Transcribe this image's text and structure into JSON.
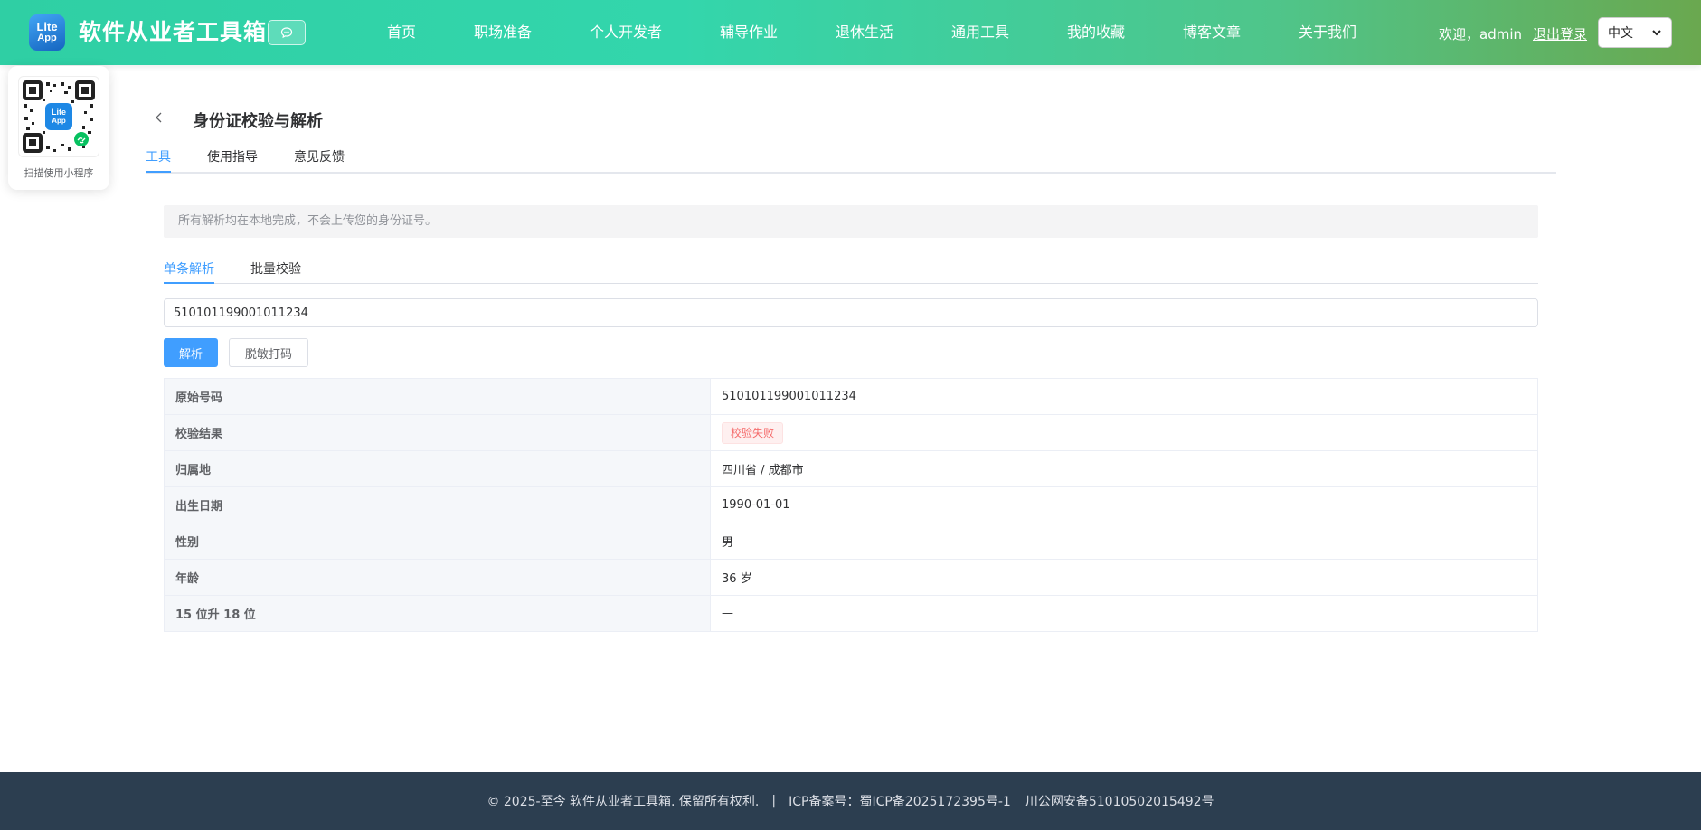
{
  "header": {
    "logo_line1": "Lite",
    "logo_line2": "App",
    "site_title": "软件从业者工具箱",
    "nav": [
      {
        "label": "首页"
      },
      {
        "label": "职场准备"
      },
      {
        "label": "个人开发者"
      },
      {
        "label": "辅导作业"
      },
      {
        "label": "退休生活"
      },
      {
        "label": "通用工具"
      },
      {
        "label": "我的收藏"
      },
      {
        "label": "博客文章"
      },
      {
        "label": "关于我们"
      }
    ],
    "welcome": "欢迎，admin",
    "logout": "退出登录",
    "language": "中文"
  },
  "qr_card": {
    "logo_line1": "Lite",
    "logo_line2": "App",
    "label": "扫描使用小程序"
  },
  "page": {
    "title": "身份证校验与解析",
    "tabs": [
      {
        "label": "工具",
        "active": true
      },
      {
        "label": "使用指导",
        "active": false
      },
      {
        "label": "意见反馈",
        "active": false
      }
    ],
    "notice": "所有解析均在本地完成，不会上传您的身份证号。",
    "subtabs": [
      {
        "label": "单条解析",
        "active": true
      },
      {
        "label": "批量校验",
        "active": false
      }
    ],
    "input_value": "510101199001011234",
    "buttons": {
      "parse": "解析",
      "mask": "脱敏打码"
    },
    "results": [
      {
        "key": "原始号码",
        "value": "510101199001011234"
      },
      {
        "key": "校验结果",
        "value": "校验失败",
        "type": "tag-danger"
      },
      {
        "key": "归属地",
        "value": "四川省 / 成都市"
      },
      {
        "key": "出生日期",
        "value": "1990-01-01"
      },
      {
        "key": "性别",
        "value": "男"
      },
      {
        "key": "年龄",
        "value": "36 岁"
      },
      {
        "key": "15 位升 18 位",
        "value": "—"
      }
    ]
  },
  "footer": {
    "copyright": "© 2025-至今 软件从业者工具箱. 保留所有权利.",
    "separator": "|",
    "icp": "ICP备案号：蜀ICP备2025172395号-1",
    "police": "川公网安备51010502015492号"
  },
  "colors": {
    "primary": "#409eff",
    "danger": "#f56c6c",
    "header_gradient_start": "#2fcfa4",
    "header_gradient_end": "#6aa84f",
    "footer_bg": "#2c3e50"
  }
}
